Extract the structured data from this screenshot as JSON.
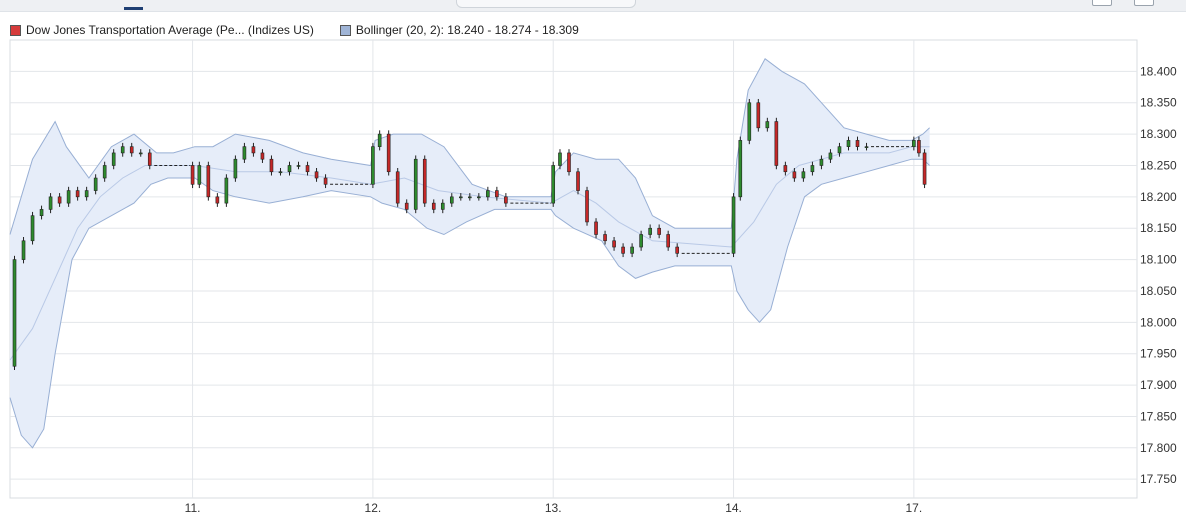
{
  "colors": {
    "up": "#2e8b2e",
    "down": "#c62828",
    "band_fill": "#e6edf9",
    "band_line": "#98afd4",
    "grid": "#e3e6ea",
    "legend_price_swatch": "#d63b3b",
    "legend_boll_swatch": "#9fb4d6"
  },
  "legend": {
    "price_label": "Dow Jones Transportation Average (Pe... (Indizes US)",
    "bollinger_label": "Bollinger (20, 2): 18.240 - 18.274 - 18.309"
  },
  "chart_data": {
    "type": "candlestick",
    "y_axis_position": "right",
    "ylim": [
      17.72,
      18.45
    ],
    "yticks": [
      {
        "value": 18.4,
        "label": "18.400"
      },
      {
        "value": 18.35,
        "label": "18.350"
      },
      {
        "value": 18.3,
        "label": "18.300"
      },
      {
        "value": 18.25,
        "label": "18.250"
      },
      {
        "value": 18.2,
        "label": "18.200"
      },
      {
        "value": 18.15,
        "label": "18.150"
      },
      {
        "value": 18.1,
        "label": "18.100"
      },
      {
        "value": 18.05,
        "label": "18.050"
      },
      {
        "value": 18.0,
        "label": "18.000"
      },
      {
        "value": 17.95,
        "label": "17.950"
      },
      {
        "value": 17.9,
        "label": "17.900"
      },
      {
        "value": 17.85,
        "label": "17.850"
      },
      {
        "value": 17.8,
        "label": "17.800"
      },
      {
        "value": 17.75,
        "label": "17.750"
      }
    ],
    "x_domain": [
      0,
      100
    ],
    "xticks": [
      {
        "x": 16.2,
        "label": "11."
      },
      {
        "x": 32.2,
        "label": "12."
      },
      {
        "x": 48.2,
        "label": "13."
      },
      {
        "x": 64.2,
        "label": "14."
      },
      {
        "x": 80.2,
        "label": "17."
      }
    ],
    "grid": true,
    "legend_position": "top-left",
    "series": [
      {
        "kind": "price",
        "points": [
          {
            "x": 0.0,
            "y": 17.93
          },
          {
            "x": 0.8,
            "y": 18.1
          },
          {
            "x": 1.6,
            "y": 18.13
          },
          {
            "x": 2.4,
            "y": 18.17
          },
          {
            "x": 3.2,
            "y": 18.18
          },
          {
            "x": 4.0,
            "y": 18.2
          },
          {
            "x": 4.8,
            "y": 18.19
          },
          {
            "x": 5.6,
            "y": 18.21
          },
          {
            "x": 6.4,
            "y": 18.2
          },
          {
            "x": 7.2,
            "y": 18.21
          },
          {
            "x": 8.0,
            "y": 18.23
          },
          {
            "x": 8.8,
            "y": 18.25
          },
          {
            "x": 9.6,
            "y": 18.27
          },
          {
            "x": 10.4,
            "y": 18.28
          },
          {
            "x": 11.2,
            "y": 18.27
          },
          {
            "x": 12.0,
            "y": 18.27
          },
          {
            "x": 12.8,
            "y": 18.25
          },
          {
            "x": 16.0,
            "y": 18.25
          },
          {
            "x": 16.4,
            "y": 18.22
          },
          {
            "x": 17.2,
            "y": 18.25
          },
          {
            "x": 18.0,
            "y": 18.2
          },
          {
            "x": 18.8,
            "y": 18.19
          },
          {
            "x": 19.6,
            "y": 18.23
          },
          {
            "x": 20.4,
            "y": 18.26
          },
          {
            "x": 21.2,
            "y": 18.28
          },
          {
            "x": 22.0,
            "y": 18.27
          },
          {
            "x": 22.8,
            "y": 18.26
          },
          {
            "x": 23.6,
            "y": 18.24
          },
          {
            "x": 24.4,
            "y": 18.24
          },
          {
            "x": 25.2,
            "y": 18.25
          },
          {
            "x": 26.0,
            "y": 18.25
          },
          {
            "x": 26.8,
            "y": 18.24
          },
          {
            "x": 27.6,
            "y": 18.23
          },
          {
            "x": 28.4,
            "y": 18.22
          },
          {
            "x": 32.0,
            "y": 18.22
          },
          {
            "x": 32.4,
            "y": 18.28
          },
          {
            "x": 33.2,
            "y": 18.3
          },
          {
            "x": 34.0,
            "y": 18.24
          },
          {
            "x": 34.8,
            "y": 18.19
          },
          {
            "x": 35.6,
            "y": 18.18
          },
          {
            "x": 36.4,
            "y": 18.26
          },
          {
            "x": 37.2,
            "y": 18.19
          },
          {
            "x": 38.0,
            "y": 18.18
          },
          {
            "x": 38.8,
            "y": 18.19
          },
          {
            "x": 39.6,
            "y": 18.2
          },
          {
            "x": 40.4,
            "y": 18.2
          },
          {
            "x": 41.2,
            "y": 18.2
          },
          {
            "x": 42.0,
            "y": 18.2
          },
          {
            "x": 42.8,
            "y": 18.21
          },
          {
            "x": 43.6,
            "y": 18.2
          },
          {
            "x": 44.4,
            "y": 18.19
          },
          {
            "x": 48.0,
            "y": 18.19
          },
          {
            "x": 48.4,
            "y": 18.25
          },
          {
            "x": 49.2,
            "y": 18.27
          },
          {
            "x": 50.0,
            "y": 18.24
          },
          {
            "x": 50.8,
            "y": 18.21
          },
          {
            "x": 51.6,
            "y": 18.16
          },
          {
            "x": 52.4,
            "y": 18.14
          },
          {
            "x": 53.2,
            "y": 18.13
          },
          {
            "x": 54.0,
            "y": 18.12
          },
          {
            "x": 54.8,
            "y": 18.11
          },
          {
            "x": 55.6,
            "y": 18.12
          },
          {
            "x": 56.4,
            "y": 18.14
          },
          {
            "x": 57.2,
            "y": 18.15
          },
          {
            "x": 58.0,
            "y": 18.14
          },
          {
            "x": 58.8,
            "y": 18.12
          },
          {
            "x": 59.6,
            "y": 18.11
          },
          {
            "x": 64.0,
            "y": 18.11
          },
          {
            "x": 64.4,
            "y": 18.2
          },
          {
            "x": 65.2,
            "y": 18.29
          },
          {
            "x": 66.0,
            "y": 18.35
          },
          {
            "x": 66.8,
            "y": 18.31
          },
          {
            "x": 67.6,
            "y": 18.32
          },
          {
            "x": 68.4,
            "y": 18.25
          },
          {
            "x": 69.2,
            "y": 18.24
          },
          {
            "x": 70.0,
            "y": 18.23
          },
          {
            "x": 70.8,
            "y": 18.24
          },
          {
            "x": 71.6,
            "y": 18.25
          },
          {
            "x": 72.4,
            "y": 18.26
          },
          {
            "x": 73.2,
            "y": 18.27
          },
          {
            "x": 74.0,
            "y": 18.28
          },
          {
            "x": 74.8,
            "y": 18.29
          },
          {
            "x": 75.6,
            "y": 18.28
          },
          {
            "x": 76.4,
            "y": 18.28
          },
          {
            "x": 80.0,
            "y": 18.28
          },
          {
            "x": 80.4,
            "y": 18.29
          },
          {
            "x": 80.9,
            "y": 18.27
          },
          {
            "x": 81.4,
            "y": 18.22
          }
        ]
      },
      {
        "kind": "bollinger_upper",
        "points": [
          {
            "x": 0.0,
            "y": 18.14
          },
          {
            "x": 2.0,
            "y": 18.26
          },
          {
            "x": 4.0,
            "y": 18.32
          },
          {
            "x": 5.0,
            "y": 18.28
          },
          {
            "x": 7.0,
            "y": 18.23
          },
          {
            "x": 9.0,
            "y": 18.28
          },
          {
            "x": 11.0,
            "y": 18.3
          },
          {
            "x": 13.0,
            "y": 18.27
          },
          {
            "x": 14.5,
            "y": 18.27
          },
          {
            "x": 16.4,
            "y": 18.28
          },
          {
            "x": 18.0,
            "y": 18.28
          },
          {
            "x": 20.0,
            "y": 18.3
          },
          {
            "x": 23.0,
            "y": 18.29
          },
          {
            "x": 26.0,
            "y": 18.27
          },
          {
            "x": 28.5,
            "y": 18.26
          },
          {
            "x": 32.0,
            "y": 18.25
          },
          {
            "x": 32.4,
            "y": 18.29
          },
          {
            "x": 34.0,
            "y": 18.3
          },
          {
            "x": 36.5,
            "y": 18.3
          },
          {
            "x": 38.5,
            "y": 18.28
          },
          {
            "x": 41.0,
            "y": 18.22
          },
          {
            "x": 44.0,
            "y": 18.2
          },
          {
            "x": 48.0,
            "y": 18.2
          },
          {
            "x": 48.4,
            "y": 18.24
          },
          {
            "x": 50.0,
            "y": 18.27
          },
          {
            "x": 52.0,
            "y": 18.26
          },
          {
            "x": 54.0,
            "y": 18.26
          },
          {
            "x": 55.5,
            "y": 18.23
          },
          {
            "x": 57.0,
            "y": 18.17
          },
          {
            "x": 59.0,
            "y": 18.15
          },
          {
            "x": 64.0,
            "y": 18.15
          },
          {
            "x": 64.5,
            "y": 18.26
          },
          {
            "x": 65.5,
            "y": 18.37
          },
          {
            "x": 67.0,
            "y": 18.42
          },
          {
            "x": 68.5,
            "y": 18.4
          },
          {
            "x": 70.5,
            "y": 18.38
          },
          {
            "x": 72.0,
            "y": 18.35
          },
          {
            "x": 74.0,
            "y": 18.31
          },
          {
            "x": 76.0,
            "y": 18.3
          },
          {
            "x": 78.0,
            "y": 18.29
          },
          {
            "x": 80.0,
            "y": 18.29
          },
          {
            "x": 81.0,
            "y": 18.3
          },
          {
            "x": 81.6,
            "y": 18.31
          }
        ]
      },
      {
        "kind": "bollinger_lower",
        "points": [
          {
            "x": 0.0,
            "y": 17.88
          },
          {
            "x": 1.0,
            "y": 17.82
          },
          {
            "x": 2.0,
            "y": 17.8
          },
          {
            "x": 3.0,
            "y": 17.83
          },
          {
            "x": 4.0,
            "y": 17.95
          },
          {
            "x": 5.5,
            "y": 18.1
          },
          {
            "x": 7.0,
            "y": 18.15
          },
          {
            "x": 9.0,
            "y": 18.17
          },
          {
            "x": 11.0,
            "y": 18.19
          },
          {
            "x": 12.5,
            "y": 18.22
          },
          {
            "x": 14.0,
            "y": 18.23
          },
          {
            "x": 16.4,
            "y": 18.23
          },
          {
            "x": 18.0,
            "y": 18.21
          },
          {
            "x": 20.0,
            "y": 18.2
          },
          {
            "x": 23.0,
            "y": 18.19
          },
          {
            "x": 26.0,
            "y": 18.2
          },
          {
            "x": 28.5,
            "y": 18.21
          },
          {
            "x": 32.0,
            "y": 18.2
          },
          {
            "x": 33.0,
            "y": 18.19
          },
          {
            "x": 35.0,
            "y": 18.18
          },
          {
            "x": 37.0,
            "y": 18.15
          },
          {
            "x": 38.5,
            "y": 18.14
          },
          {
            "x": 40.5,
            "y": 18.16
          },
          {
            "x": 43.0,
            "y": 18.18
          },
          {
            "x": 48.0,
            "y": 18.18
          },
          {
            "x": 48.4,
            "y": 18.17
          },
          {
            "x": 50.0,
            "y": 18.15
          },
          {
            "x": 52.5,
            "y": 18.13
          },
          {
            "x": 54.0,
            "y": 18.09
          },
          {
            "x": 55.5,
            "y": 18.07
          },
          {
            "x": 57.0,
            "y": 18.08
          },
          {
            "x": 59.0,
            "y": 18.09
          },
          {
            "x": 64.0,
            "y": 18.09
          },
          {
            "x": 64.5,
            "y": 18.05
          },
          {
            "x": 65.5,
            "y": 18.02
          },
          {
            "x": 66.5,
            "y": 18.0
          },
          {
            "x": 67.5,
            "y": 18.02
          },
          {
            "x": 69.0,
            "y": 18.12
          },
          {
            "x": 70.5,
            "y": 18.2
          },
          {
            "x": 72.0,
            "y": 18.22
          },
          {
            "x": 74.0,
            "y": 18.23
          },
          {
            "x": 76.0,
            "y": 18.24
          },
          {
            "x": 78.0,
            "y": 18.25
          },
          {
            "x": 80.0,
            "y": 18.26
          },
          {
            "x": 81.0,
            "y": 18.26
          },
          {
            "x": 81.6,
            "y": 18.25
          }
        ]
      },
      {
        "kind": "bollinger_middle",
        "points": [
          {
            "x": 0.0,
            "y": 17.94
          },
          {
            "x": 2.0,
            "y": 17.99
          },
          {
            "x": 4.0,
            "y": 18.07
          },
          {
            "x": 6.0,
            "y": 18.15
          },
          {
            "x": 8.0,
            "y": 18.2
          },
          {
            "x": 10.0,
            "y": 18.23
          },
          {
            "x": 12.0,
            "y": 18.25
          },
          {
            "x": 14.0,
            "y": 18.25
          },
          {
            "x": 16.4,
            "y": 18.25
          },
          {
            "x": 20.0,
            "y": 18.24
          },
          {
            "x": 24.0,
            "y": 18.24
          },
          {
            "x": 28.5,
            "y": 18.23
          },
          {
            "x": 32.0,
            "y": 18.22
          },
          {
            "x": 35.0,
            "y": 18.23
          },
          {
            "x": 38.0,
            "y": 18.21
          },
          {
            "x": 42.0,
            "y": 18.2
          },
          {
            "x": 48.0,
            "y": 18.19
          },
          {
            "x": 50.0,
            "y": 18.21
          },
          {
            "x": 52.0,
            "y": 18.19
          },
          {
            "x": 54.0,
            "y": 18.16
          },
          {
            "x": 57.0,
            "y": 18.13
          },
          {
            "x": 64.0,
            "y": 18.12
          },
          {
            "x": 66.0,
            "y": 18.16
          },
          {
            "x": 68.0,
            "y": 18.22
          },
          {
            "x": 70.0,
            "y": 18.25
          },
          {
            "x": 72.0,
            "y": 18.26
          },
          {
            "x": 74.0,
            "y": 18.27
          },
          {
            "x": 76.0,
            "y": 18.27
          },
          {
            "x": 78.0,
            "y": 18.27
          },
          {
            "x": 80.0,
            "y": 18.28
          },
          {
            "x": 81.6,
            "y": 18.28
          }
        ]
      }
    ]
  }
}
